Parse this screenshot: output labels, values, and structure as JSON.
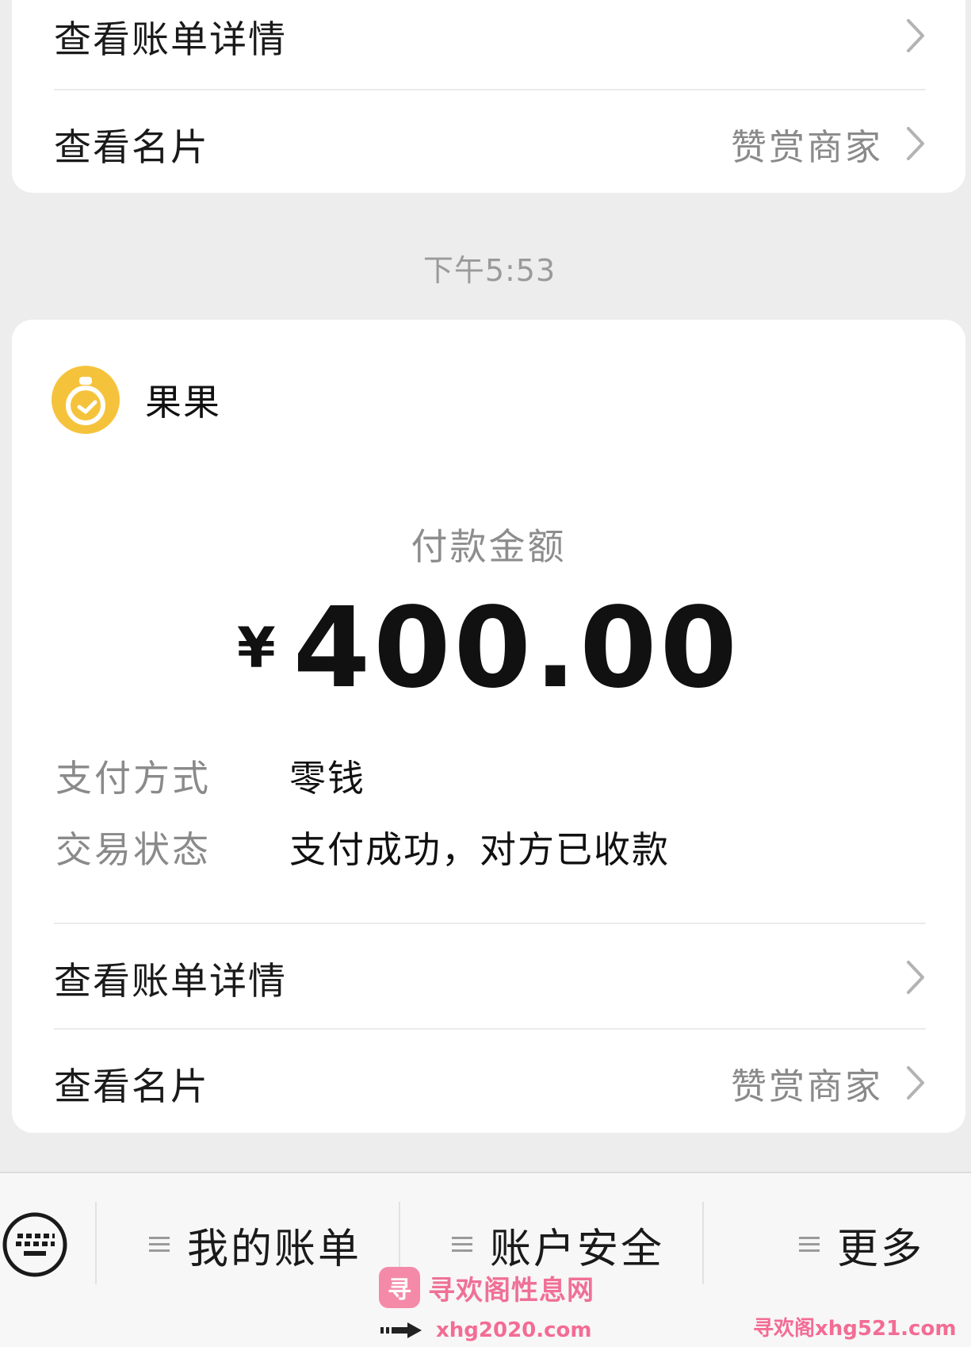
{
  "top_card": {
    "bill_label": "查看账单详情",
    "card_label": "查看名片",
    "card_sub": "赞赏商家"
  },
  "time": "下午5:53",
  "payment": {
    "merchant": "果果",
    "amount_label": "付款金额",
    "currency": "¥",
    "amount": "400.00",
    "method_key": "支付方式",
    "method_value": "零钱",
    "status_key": "交易状态",
    "status_value": "支付成功，对方已收款",
    "bill_label": "查看账单详情",
    "card_label": "查看名片",
    "card_sub": "赞赏商家"
  },
  "bottom_tabs": [
    {
      "label": "我的账单"
    },
    {
      "label": "账户安全"
    },
    {
      "label": "更多"
    }
  ],
  "watermark": {
    "logo": "寻",
    "text": "寻欢阁性息网",
    "url_center": "xhg2020.com",
    "url_right": "寻欢阁xhg521.com"
  },
  "colors": {
    "background": "#ededed",
    "card": "#ffffff",
    "avatar": "#f5c33b",
    "watermark": "#f07096"
  },
  "icons": [
    "chevron-right-icon",
    "merchant-avatar-icon",
    "keyboard-icon",
    "menu-icon"
  ]
}
